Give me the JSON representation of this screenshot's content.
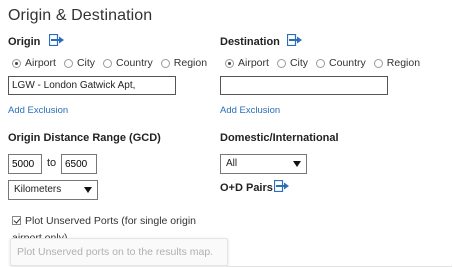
{
  "title": "Origin & Destination",
  "origin": {
    "label": "Origin",
    "radios": [
      {
        "label": "Airport",
        "selected": true
      },
      {
        "label": "City",
        "selected": false
      },
      {
        "label": "Country",
        "selected": false
      },
      {
        "label": "Region",
        "selected": false
      }
    ],
    "input_value": "LGW - London Gatwick Apt,",
    "add_exclusion": "Add Exclusion"
  },
  "destination": {
    "label": "Destination",
    "radios": [
      {
        "label": "Airport",
        "selected": true
      },
      {
        "label": "City",
        "selected": false
      },
      {
        "label": "Country",
        "selected": false
      },
      {
        "label": "Region",
        "selected": false
      }
    ],
    "input_value": "",
    "add_exclusion": "Add Exclusion"
  },
  "distance": {
    "label": "Origin Distance Range (GCD)",
    "min": "5000",
    "to_label": "to",
    "max": "6500",
    "unit": "Kilometers"
  },
  "domestic": {
    "label": "Domestic/International",
    "value": "All"
  },
  "od_pairs": {
    "label": "O+D Pairs"
  },
  "plot_unserved": {
    "checked": true,
    "label": "Plot Unserved Ports (for single origin airport only)"
  },
  "tooltip": "Plot Unserved ports on to the results map.",
  "icons": {
    "io_icon": "import-export-icon",
    "accent": "#2a6fb8"
  }
}
